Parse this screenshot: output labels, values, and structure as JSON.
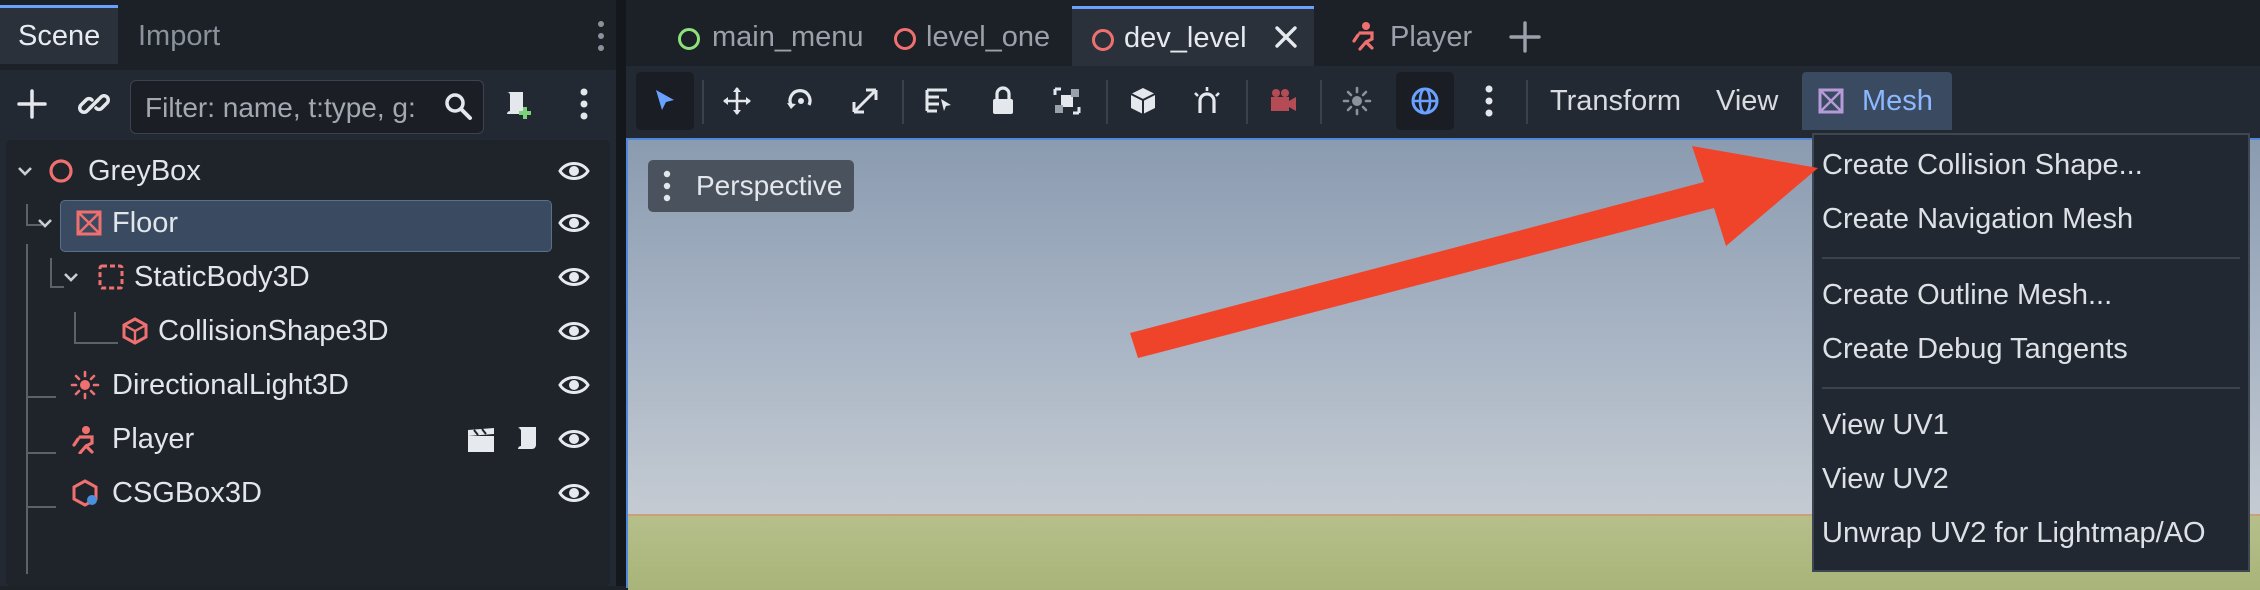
{
  "dock": {
    "tabs": [
      {
        "label": "Scene"
      },
      {
        "label": "Import"
      }
    ],
    "filter": {
      "placeholder": "Filter: name, t:type, g:"
    }
  },
  "tree": [
    {
      "label": "GreyBox",
      "icon": "node3d-icon"
    },
    {
      "label": "Floor",
      "icon": "mesh-instance-icon",
      "selected": true
    },
    {
      "label": "StaticBody3D",
      "icon": "static-body-icon"
    },
    {
      "label": "CollisionShape3D",
      "icon": "collision-shape-icon"
    },
    {
      "label": "DirectionalLight3D",
      "icon": "light-icon"
    },
    {
      "label": "Player",
      "icon": "player-scene-icon"
    },
    {
      "label": "CSGBox3D",
      "icon": "csg-box-icon"
    }
  ],
  "scene_tabs": [
    {
      "label": "main_menu",
      "color": "#8ee07a"
    },
    {
      "label": "level_one",
      "color": "#f07070"
    },
    {
      "label": "dev_level",
      "color": "#f07070",
      "active": true
    },
    {
      "label": "Player",
      "color": "#f07070"
    }
  ],
  "viewport_menus": {
    "transform": "Transform",
    "view": "View",
    "mesh": "Mesh"
  },
  "viewport": {
    "perspective": "Perspective"
  },
  "mesh_menu": [
    "Create Collision Shape...",
    "Create Navigation Mesh",
    "Create Outline Mesh...",
    "Create Debug Tangents",
    "View UV1",
    "View UV2",
    "Unwrap UV2 for Lightmap/AO"
  ],
  "colors": {
    "accent": "#6aa1ff",
    "node_red": "#f07070",
    "arrow": "#f0442a"
  }
}
